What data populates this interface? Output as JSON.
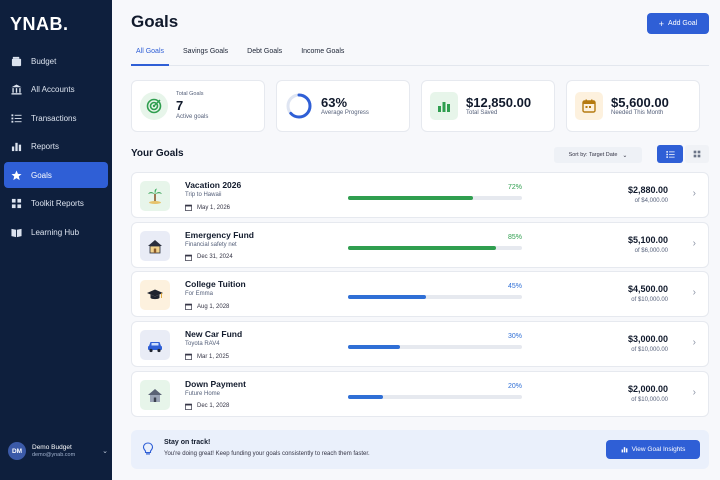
{
  "app": {
    "logo": "YNAB."
  },
  "sidebar": {
    "items": [
      {
        "label": "Budget",
        "icon": "wallet-icon",
        "active": false
      },
      {
        "label": "All Accounts",
        "icon": "bank-icon",
        "active": false
      },
      {
        "label": "Transactions",
        "icon": "list-icon",
        "active": false
      },
      {
        "label": "Reports",
        "icon": "bar-chart-icon",
        "active": false
      },
      {
        "label": "Goals",
        "icon": "star-icon",
        "active": true
      },
      {
        "label": "Toolkit Reports",
        "icon": "grid-report-icon",
        "active": false
      },
      {
        "label": "Learning Hub",
        "icon": "book-icon",
        "active": false
      }
    ],
    "user": {
      "initials": "DM",
      "name": "Demo Budget",
      "email": "demo@ynab.com"
    }
  },
  "header": {
    "title": "Goals",
    "add_label": "Add Goal"
  },
  "tabs": [
    {
      "label": "All Goals",
      "active": true
    },
    {
      "label": "Savings Goals",
      "active": false
    },
    {
      "label": "Debt Goals",
      "active": false
    },
    {
      "label": "Income Goals",
      "active": false
    }
  ],
  "stats": [
    {
      "top": "Total Goals",
      "value": "7",
      "label": "Active goals",
      "icon": "target-icon",
      "color": "#2f9e4f"
    },
    {
      "top": "",
      "value": "63%",
      "label": "Average Progress",
      "icon": "progress-ring-icon",
      "color": "#2f5fd6",
      "progress": 0.63
    },
    {
      "top": "",
      "value": "$12,850.00",
      "label": "Total Saved",
      "icon": "bar-chart-icon",
      "color": "#2f9e4f"
    },
    {
      "top": "",
      "value": "$5,600.00",
      "label": "Needed This Month",
      "icon": "calendar-icon",
      "color": "#d99a1e"
    }
  ],
  "goals_section": {
    "title": "Your Goals",
    "sort_label": "Sort by: Target Date"
  },
  "goals": [
    {
      "name": "Vacation 2026",
      "desc": "Trip to Hawaii",
      "date": "May 1, 2026",
      "pct": "72%",
      "progress": 0.72,
      "color": "#2f9e4f",
      "amount": "$2,880.00",
      "of": "of $4,000.00",
      "icon": "palm-tree-icon",
      "icon_bg": "#e7f5ea"
    },
    {
      "name": "Emergency Fund",
      "desc": "Financial safety net",
      "date": "Dec 31, 2024",
      "pct": "85%",
      "progress": 0.85,
      "color": "#2f9e4f",
      "amount": "$5,100.00",
      "of": "of $6,000.00",
      "icon": "house-icon",
      "icon_bg": "#e9ecf6"
    },
    {
      "name": "College Tuition",
      "desc": "For Emma",
      "date": "Aug 1, 2028",
      "pct": "45%",
      "progress": 0.45,
      "color": "#2f6fd6",
      "amount": "$4,500.00",
      "of": "of $10,000.00",
      "icon": "grad-cap-icon",
      "icon_bg": "#fdf1de"
    },
    {
      "name": "New Car Fund",
      "desc": "Toyota RAV4",
      "date": "Mar 1, 2025",
      "pct": "30%",
      "progress": 0.3,
      "color": "#2f6fd6",
      "amount": "$3,000.00",
      "of": "of $10,000.00",
      "icon": "car-icon",
      "icon_bg": "#e9ecf6"
    },
    {
      "name": "Down Payment",
      "desc": "Future Home",
      "date": "Dec 1, 2028",
      "pct": "20%",
      "progress": 0.2,
      "color": "#2f6fd6",
      "amount": "$2,000.00",
      "of": "of $10,000.00",
      "icon": "home-icon",
      "icon_bg": "#e7f5ea"
    }
  ],
  "banner": {
    "title": "Stay on track!",
    "text": "You're doing great! Keep funding your goals consistently to reach them faster.",
    "button": "View Goal Insights"
  }
}
